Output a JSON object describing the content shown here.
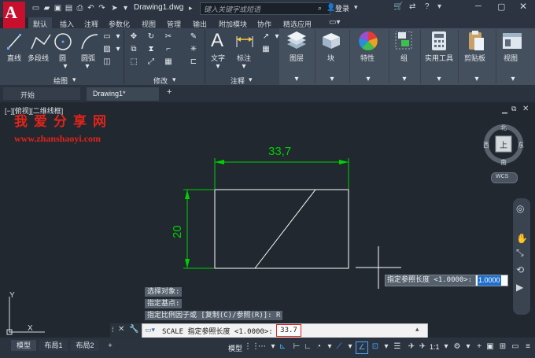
{
  "titlebar": {
    "filename": "Drawing1.dwg",
    "search_placeholder": "键入关键字或短语",
    "login": "登录",
    "logo_letter": "A"
  },
  "menu": {
    "tabs": [
      "默认",
      "插入",
      "注释",
      "参数化",
      "视图",
      "管理",
      "输出",
      "附加模块",
      "协作",
      "精选应用"
    ]
  },
  "ribbon": {
    "draw_tools": [
      "直线",
      "多段线",
      "圆",
      "圆弧"
    ],
    "panel_draw": "绘图",
    "panel_modify": "修改",
    "annot_tools": [
      "文字",
      "标注"
    ],
    "panel_annot": "注释",
    "big_tools": [
      "图层",
      "块",
      "特性",
      "组",
      "实用工具",
      "剪贴板",
      "视图"
    ]
  },
  "filetabs": {
    "start": "开始",
    "drawing": "Drawing1*",
    "add": "+"
  },
  "canvas": {
    "view_label": "[−][俯视][二维线框]",
    "watermark_cn": "我爱分享网",
    "watermark_url": "www.zhanshaoyi.com",
    "dim_width": "33,7",
    "dim_height": "20",
    "ucs_y": "Y",
    "ucs_x": "X",
    "viewcube": {
      "north": "北",
      "south": "南",
      "west": "西",
      "east": "东",
      "top": "上",
      "wcs": "WCS"
    }
  },
  "command": {
    "history": [
      "选择对象:",
      "指定基点:",
      "指定比例因子或 [复制(C)/参照(R)]: R"
    ],
    "line_text": "SCALE 指定参照长度 <1.0000>:",
    "value": "33.7"
  },
  "dynamic_input": {
    "prompt": "指定参照长度 <1.0000>:",
    "value": "1.0000"
  },
  "statusbar": {
    "tabs": [
      "模型",
      "布局1",
      "布局2"
    ],
    "add": "+",
    "mode": "模型",
    "scale": "1:1"
  },
  "colors": {
    "dimension": "#00d000",
    "geometry": "#ffffff",
    "brand_red": "#c8102e"
  }
}
